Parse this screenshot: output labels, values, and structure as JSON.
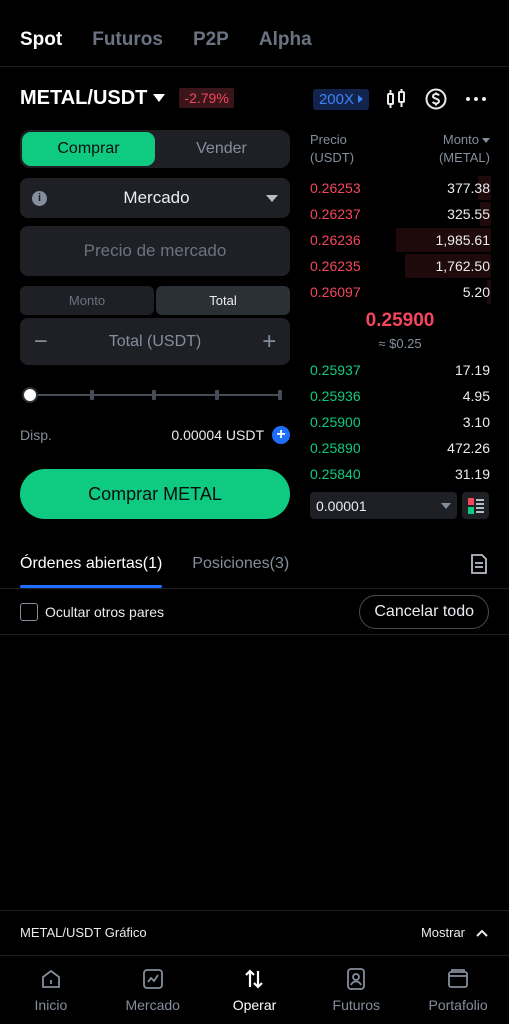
{
  "top_tabs": [
    {
      "label": "Spot",
      "active": true
    },
    {
      "label": "Futuros",
      "active": false
    },
    {
      "label": "P2P",
      "active": false
    },
    {
      "label": "Alpha",
      "active": false
    }
  ],
  "pair": {
    "name": "METAL/USDT",
    "change": "-2.79%",
    "leverage": "200X"
  },
  "trade": {
    "buy_label": "Comprar",
    "sell_label": "Vender",
    "order_type": "Mercado",
    "price_placeholder": "Precio de mercado",
    "amount_label": "Monto",
    "total_label": "Total",
    "total_placeholder": "Total (USDT)",
    "available_label": "Disp.",
    "available_value": "0.00004 USDT",
    "submit_label": "Comprar  METAL",
    "slider_percent": 0
  },
  "order_book": {
    "price_header_1": "Precio",
    "price_header_2": "(USDT)",
    "amount_header_1": "Monto",
    "amount_header_2": "(METAL)",
    "asks": [
      {
        "price": "0.26253",
        "qty": "377.38",
        "depth": 0.07
      },
      {
        "price": "0.26237",
        "qty": "325.55",
        "depth": 0.06
      },
      {
        "price": "0.26236",
        "qty": "1,985.61",
        "depth": 0.53
      },
      {
        "price": "0.26235",
        "qty": "1,762.50",
        "depth": 0.48
      },
      {
        "price": "0.26097",
        "qty": "5.20",
        "depth": 0.02
      }
    ],
    "mid_price": "0.25900",
    "mid_usd": "≈ $0.25",
    "bids": [
      {
        "price": "0.25937",
        "qty": "17.19"
      },
      {
        "price": "0.25936",
        "qty": "4.95"
      },
      {
        "price": "0.25900",
        "qty": "3.10"
      },
      {
        "price": "0.25890",
        "qty": "472.26"
      },
      {
        "price": "0.25840",
        "qty": "31.19"
      }
    ],
    "precision": "0.00001"
  },
  "orders": {
    "tab_open": "Órdenes abiertas(1)",
    "tab_positions": "Posiciones(3)",
    "hide_pairs_label": "Ocultar otros pares",
    "cancel_all_label": "Cancelar todo"
  },
  "chart_bar": {
    "label": "METAL/USDT Gráfico",
    "show_label": "Mostrar"
  },
  "bottom_nav": [
    {
      "label": "Inicio",
      "icon": "home-icon",
      "active": false
    },
    {
      "label": "Mercado",
      "icon": "market-chart-icon",
      "active": false
    },
    {
      "label": "Operar",
      "icon": "trade-arrows-icon",
      "active": true
    },
    {
      "label": "Futuros",
      "icon": "futures-icon",
      "active": false
    },
    {
      "label": "Portafolio",
      "icon": "wallet-icon",
      "active": false
    }
  ],
  "colors": {
    "buy_green": "#0ecb81",
    "sell_red": "#f6465d",
    "accent_blue": "#1f6fff",
    "background": "#000000"
  }
}
